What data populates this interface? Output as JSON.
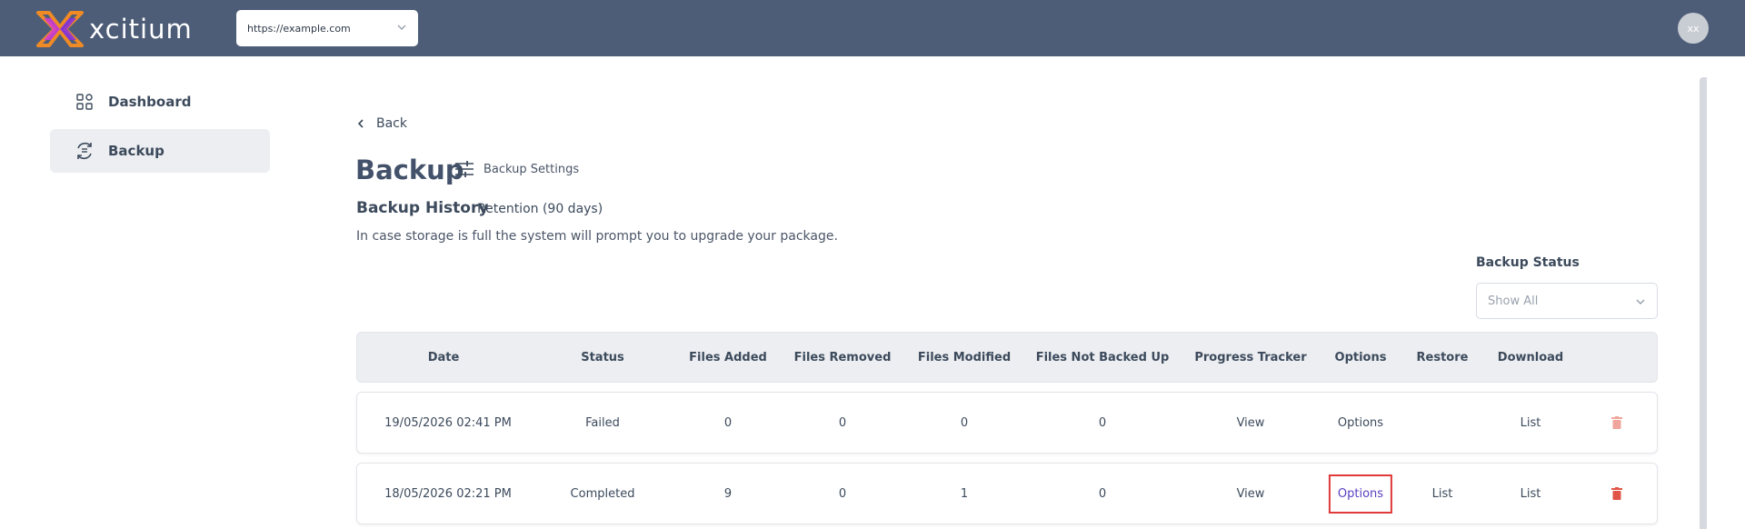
{
  "topbar": {
    "logo_text": "xcitium",
    "url_value": "https://example.com",
    "avatar_initials": "xx",
    "bg_color": "#4d5d78"
  },
  "sidebar": {
    "items": [
      {
        "label": "Dashboard",
        "icon": "dashboard-icon",
        "active": false
      },
      {
        "label": "Backup",
        "icon": "backup-icon",
        "active": true
      }
    ]
  },
  "content": {
    "back_label": "Back",
    "page_title": "Backup",
    "settings_label": "Backup Settings",
    "history_title": "Backup History",
    "retention": "Retention (90 days)",
    "note": "In case storage is full the system will prompt you to upgrade your package."
  },
  "filter": {
    "label": "Backup Status",
    "placeholder": "Show All"
  },
  "table": {
    "columns": [
      "Date",
      "Status",
      "Files Added",
      "Files Removed",
      "Files Modified",
      "Files Not Backed Up",
      "Progress Tracker",
      "Options",
      "Restore",
      "Download"
    ],
    "rows": [
      {
        "date": "19/05/2026 02:41 PM",
        "status": "Failed",
        "files_added": "0",
        "files_removed": "0",
        "files_modified": "0",
        "files_not_backed_up": "0",
        "progress": "View",
        "options": "Options",
        "restore": "",
        "download": "List"
      },
      {
        "date": "18/05/2026 02:21 PM",
        "status": "Completed",
        "files_added": "9",
        "files_removed": "0",
        "files_modified": "1",
        "files_not_backed_up": "0",
        "progress": "View",
        "options": "Options",
        "restore": "List",
        "download": "List"
      }
    ]
  },
  "colors": {
    "link": "#5a3fc0",
    "failed": "#e06a55",
    "completed": "#1f9a52",
    "delete_active": "#e05547",
    "delete_disabled": "#f0a59c",
    "highlight": "#e03a3a"
  }
}
